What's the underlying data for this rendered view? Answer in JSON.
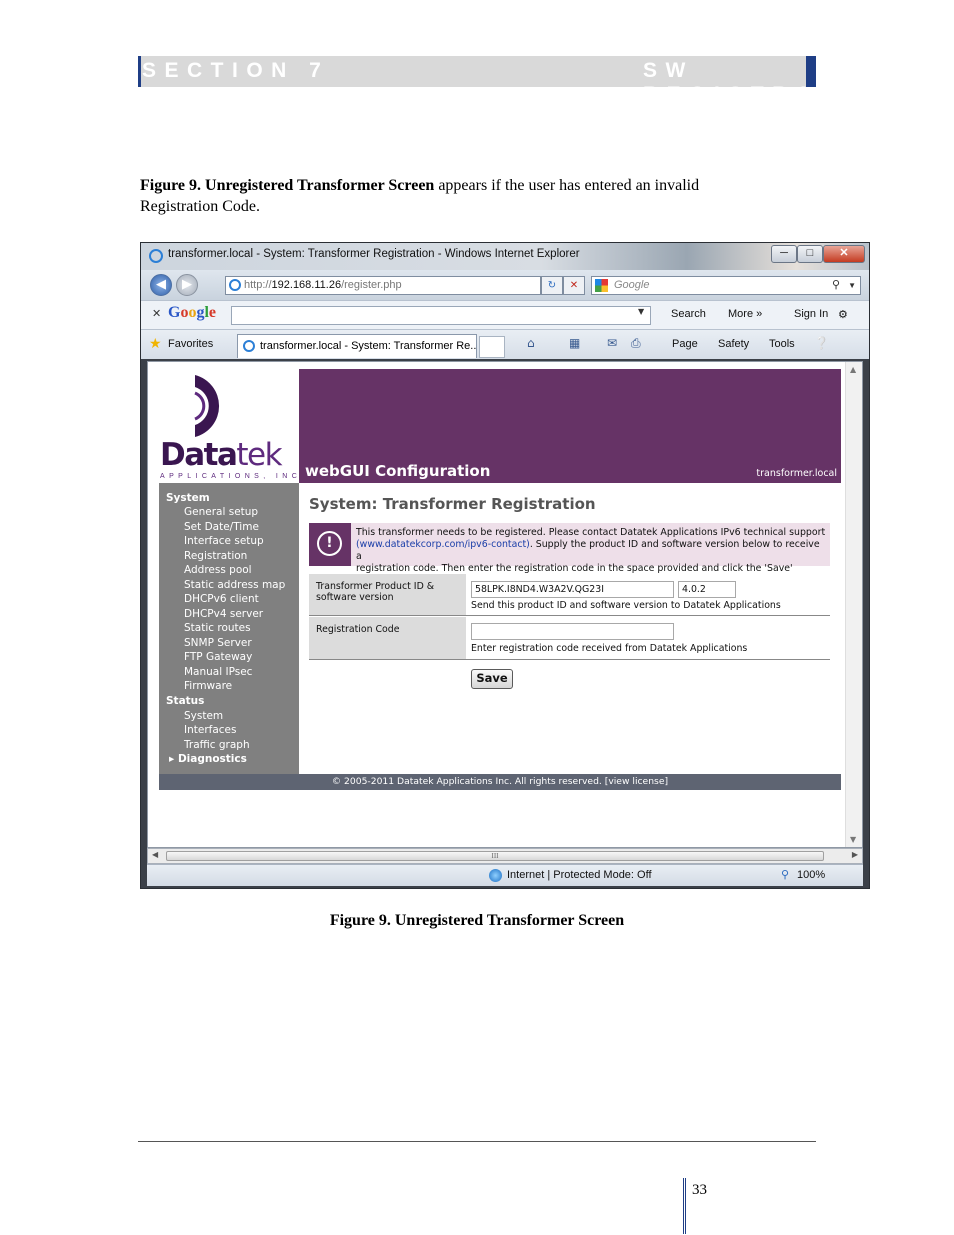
{
  "section": {
    "left": "SECTION 7",
    "right": "SW REGISTRATION"
  },
  "intro": {
    "bold": "Figure 9. Unregistered Transformer Screen",
    "rest": " appears if the user has entered an invalid Registration Code."
  },
  "browser": {
    "title": "transformer.local - System: Transformer Registration - Windows Internet Explorer",
    "window_buttons": {
      "minimize": "─",
      "maximize": "□",
      "close": "✕"
    },
    "url": {
      "prefix": "http://",
      "host": "192.168.11.26",
      "path": "/register.php"
    },
    "search_placeholder": "Google",
    "google_toolbar": {
      "logo": "Google",
      "search": "Search",
      "more": "More »",
      "sign_in": "Sign In"
    },
    "favorites_label": "Favorites",
    "tab_label": "transformer.local - System: Transformer Re...",
    "commands": {
      "page": "Page",
      "safety": "Safety",
      "tools": "Tools"
    },
    "status": {
      "zone": "Internet | Protected Mode: Off",
      "zoom": "100%"
    },
    "hscroll_grip": "III"
  },
  "webpage": {
    "logo": {
      "word_bold": "Data",
      "word_light": "tek",
      "subtitle": "APPLICATIONS, INC"
    },
    "banner": {
      "title": "webGUI Configuration",
      "host": "transformer.local"
    },
    "nav": {
      "system_label": "System",
      "system_items": [
        "General setup",
        "Set Date/Time",
        "Interface setup",
        "Registration",
        "Address pool",
        "Static address map",
        "DHCPv6 client",
        "DHCPv4 server",
        "Static routes",
        "SNMP Server",
        "FTP Gateway",
        "Manual IPsec",
        "Firmware"
      ],
      "status_label": "Status",
      "status_items": [
        "System",
        "Interfaces",
        "Traffic graph"
      ],
      "diagnostics_label": "Diagnostics"
    },
    "heading": "System: Transformer Registration",
    "alert": {
      "line1": "This transformer needs to be registered. Please contact Datatek Applications IPv6 technical support",
      "link": "(www.datatekcorp.com/ipv6-contact)",
      "line2_rest": ". Supply the product ID and software version below to receive a",
      "line3": "registration code. Then enter the registration code in the space provided and click the 'Save' button."
    },
    "form": {
      "product_label_1": "Transformer Product ID &",
      "product_label_2": "software version",
      "product_id": "58LPK.I8ND4.W3A2V.QG23I",
      "version": "4.0.2",
      "product_hint": "Send this product ID and software version to Datatek Applications",
      "reg_label": "Registration Code",
      "reg_value": "",
      "reg_hint": "Enter registration code received from Datatek Applications",
      "save_label": "Save"
    },
    "footer": "© 2005-2011 Datatek Applications Inc. All rights reserved.  [view license]"
  },
  "caption": "Figure 9. Unregistered Transformer Screen",
  "page_number": "33",
  "colors": {
    "section_bar": "#1f3e86",
    "banner": "#663366",
    "nav": "#808080",
    "footer": "#5e6472",
    "alert_bg": "#eedfe9"
  }
}
